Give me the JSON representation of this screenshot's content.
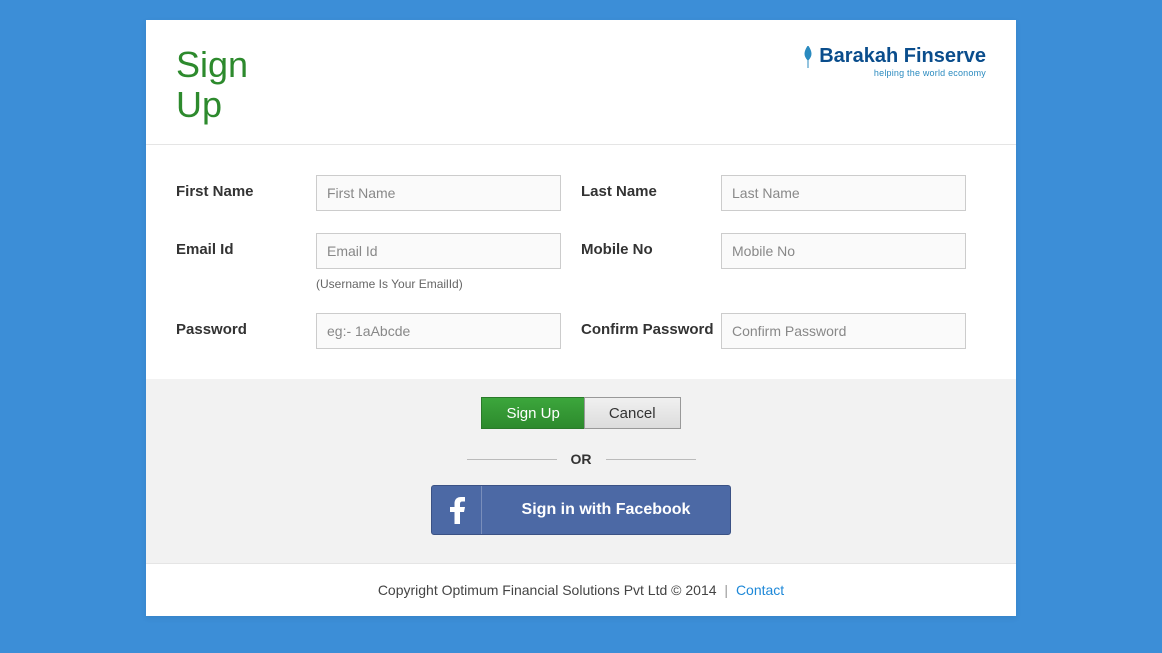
{
  "header": {
    "title": "Sign Up",
    "brand_name": "Barakah Finserve",
    "brand_tagline": "helping the world economy"
  },
  "form": {
    "first_name": {
      "label": "First Name",
      "placeholder": "First Name",
      "value": ""
    },
    "last_name": {
      "label": "Last Name",
      "placeholder": "Last Name",
      "value": ""
    },
    "email": {
      "label": "Email Id",
      "placeholder": "Email Id",
      "value": "",
      "hint": "(Username Is Your EmailId)"
    },
    "mobile": {
      "label": "Mobile No",
      "placeholder": "Mobile No",
      "value": ""
    },
    "password": {
      "label": "Password",
      "placeholder": "eg:- 1aAbcde",
      "value": ""
    },
    "confirm_password": {
      "label": "Confirm Password",
      "placeholder": "Confirm Password",
      "value": ""
    }
  },
  "actions": {
    "submit": "Sign Up",
    "cancel": "Cancel",
    "or": "OR",
    "facebook": "Sign in with Facebook"
  },
  "footer": {
    "copyright": "Copyright Optimum Financial Solutions Pvt Ltd © 2014",
    "divider": "|",
    "contact": "Contact"
  }
}
